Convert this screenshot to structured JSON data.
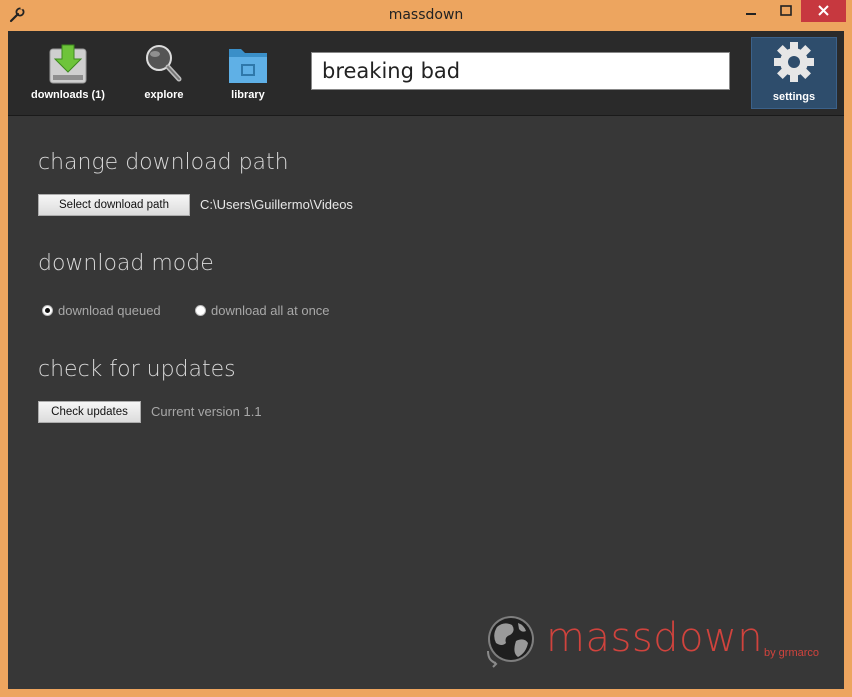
{
  "window": {
    "title": "massdown"
  },
  "nav": {
    "downloads": "downloads (1)",
    "explore": "explore",
    "library": "library",
    "settings": "settings"
  },
  "search": {
    "value": "breaking bad"
  },
  "sections": {
    "download_path": {
      "title": "change download path",
      "button": "Select download path",
      "path": "C:\\Users\\Guillermo\\Videos"
    },
    "download_mode": {
      "title": "download mode",
      "options": [
        {
          "label": "download queued",
          "selected": true
        },
        {
          "label": "download all at once",
          "selected": false
        }
      ]
    },
    "updates": {
      "title": "check for updates",
      "button": "Check updates",
      "version": "Current version 1.1"
    }
  },
  "brand": {
    "name": "massdown",
    "by": "by grmarco"
  },
  "colors": {
    "titlebar": "#eda55f",
    "background": "#373737",
    "toolbar": "#2a2a2a",
    "settings_active": "#2e4d6c",
    "brand": "#d0433d",
    "close": "#c7383f"
  },
  "icons": {
    "app": "wrench-icon",
    "downloads": "download-arrow-icon",
    "explore": "magnifier-icon",
    "library": "folder-icon",
    "settings": "gear-icon",
    "brand": "globe-icon"
  }
}
